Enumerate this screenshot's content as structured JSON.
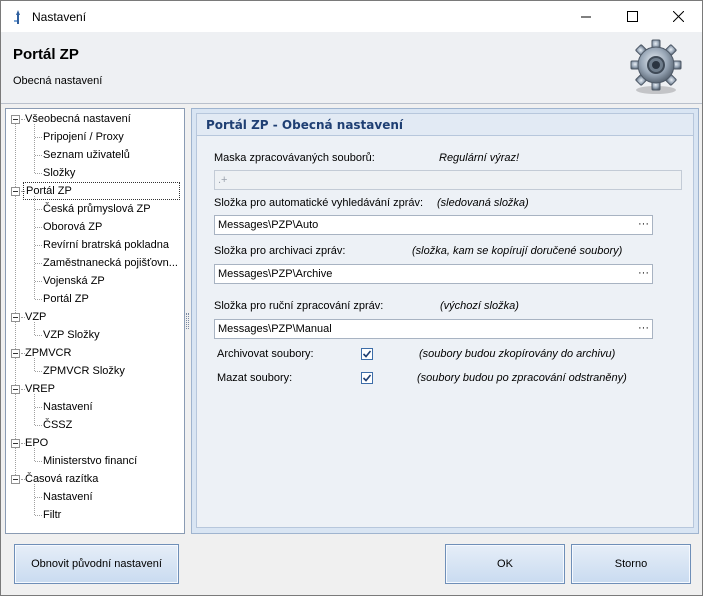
{
  "window": {
    "title": "Nastavení"
  },
  "header": {
    "title": "Portál ZP",
    "subtitle": "Obecná nastavení"
  },
  "tree": {
    "items": [
      {
        "label": "Všeobecná nastavení",
        "level": 0
      },
      {
        "label": "Pripojení / Proxy",
        "level": 1
      },
      {
        "label": "Seznam uživatelů",
        "level": 1
      },
      {
        "label": "Složky",
        "level": 1
      },
      {
        "label": "Portál ZP",
        "level": 0,
        "selected": true
      },
      {
        "label": "Česká průmyslová ZP",
        "level": 1
      },
      {
        "label": "Oborová ZP",
        "level": 1
      },
      {
        "label": "Revírní bratrská pokladna",
        "level": 1
      },
      {
        "label": "Zaměstnanecká pojišťovn...",
        "level": 1
      },
      {
        "label": "Vojenská ZP",
        "level": 1
      },
      {
        "label": "Portál ZP",
        "level": 1
      },
      {
        "label": "VZP",
        "level": 0
      },
      {
        "label": "VZP Složky",
        "level": 1
      },
      {
        "label": "ZPMVCR",
        "level": 0
      },
      {
        "label": "ZPMVCR Složky",
        "level": 1
      },
      {
        "label": "VREP",
        "level": 0
      },
      {
        "label": "Nastavení",
        "level": 1
      },
      {
        "label": "ČSSZ",
        "level": 1
      },
      {
        "label": "EPO",
        "level": 0
      },
      {
        "label": "Ministerstvo financí",
        "level": 1
      },
      {
        "label": "Časová razítka",
        "level": 0
      },
      {
        "label": "Nastavení",
        "level": 1
      },
      {
        "label": "Filtr",
        "level": 1
      }
    ]
  },
  "panel": {
    "title": "Portál ZP - Obecná nastavení",
    "mask_label": "Maska zpracovávaných souborů:",
    "mask_hint": "Regulární výraz!",
    "mask_value": ".+",
    "auto_label": "Složka pro automatické vyhledávání zpráv:",
    "auto_hint": "(sledovaná složka)",
    "auto_value": "Messages\\PZP\\Auto",
    "archive_label": "Složka pro archivaci zpráv:",
    "archive_hint": "(složka, kam se kopírují doručené soubory)",
    "archive_value": "Messages\\PZP\\Archive",
    "manual_label": "Složka pro ruční zpracování zpráv:",
    "manual_hint": "(výchozí složka)",
    "manual_value": "Messages\\PZP\\Manual",
    "browse_label": "···",
    "archive_check_label": "Archivovat soubory:",
    "archive_check_hint": "(soubory budou zkopírovány do archivu)",
    "archive_checked": true,
    "delete_check_label": "Mazat soubory:",
    "delete_check_hint": "(soubory budou po zpracování odstraněny)",
    "delete_checked": true
  },
  "buttons": {
    "restore": "Obnovit původní nastavení",
    "ok": "OK",
    "cancel": "Storno"
  }
}
